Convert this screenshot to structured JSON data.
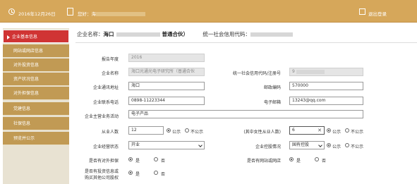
{
  "topbar": {
    "date": "2016年12月26日",
    "greeting": "您好：海",
    "logout": "退出登录"
  },
  "sidebar": {
    "items": [
      {
        "label": "企业基本信息"
      },
      {
        "label": "网站或网店信息"
      },
      {
        "label": "对外投资信息"
      },
      {
        "label": "资产状况信息"
      },
      {
        "label": "对外担保信息"
      },
      {
        "label": "党建信息"
      },
      {
        "label": "社保信息"
      },
      {
        "label": "预览并公示"
      }
    ]
  },
  "header": {
    "company_label": "企业名称：",
    "company_prefix": "海口",
    "company_suffix": "普通合伙）",
    "credit_label": "统一社会信用代码："
  },
  "form": {
    "report_year_label": "报告年度",
    "report_year": "2016",
    "company_name_label": "企业名称",
    "company_name": "海口光通光电子研究所（普通合伙",
    "credit_code_label": "统一社会信用代码/注册号",
    "credit_code": "9",
    "address_label": "企业通讯地址",
    "address": "海口",
    "postcode_label": "邮政编码",
    "postcode": "570000",
    "phone_label": "企业联系电话",
    "phone": "0898-11223344",
    "email_label": "电子邮箱",
    "email": "13243@qq.com",
    "business_label": "企业主营业务活动",
    "business": "电子产品",
    "employees_label": "从业人数",
    "employees": "12",
    "female_label": "(其中女性从业人数)",
    "female": "6",
    "status_label": "企业经营状态",
    "status": "开业",
    "holding_label": "企业控股情况",
    "holding": "国有控股",
    "guarantee_label": "是否有对外担保",
    "website_label": "是否有网站或网店",
    "invest_label_1": "是否有投资信息或",
    "invest_label_2": "购买其他公司股权",
    "public": "公示",
    "not_public": "不公示",
    "yes": "是",
    "no": "否",
    "clear": "✕"
  }
}
